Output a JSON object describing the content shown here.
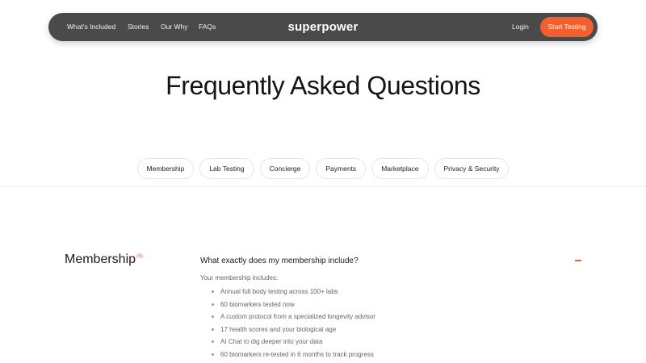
{
  "nav": {
    "links": [
      "What's Included",
      "Stories",
      "Our Why",
      "FAQs"
    ],
    "brand": "superpower",
    "login": "Login",
    "cta": "Start Testing"
  },
  "page_title": "Frequently Asked Questions",
  "categories": [
    "Membership",
    "Lab Testing",
    "Concierge",
    "Payments",
    "Marketplace",
    "Privacy & Security"
  ],
  "section": {
    "title": "Membership",
    "count": "(6)"
  },
  "faq": {
    "question": "What exactly does my membership include?",
    "answer_intro": "Your membership includes:",
    "answer_items": [
      "Annual full body testing across 100+ labs",
      "60 biomarkers tested now",
      "A custom protocol from a specialized longevity advisor",
      "17 health scores and your biological age",
      "AI Chat to dig deeper into your data",
      "60 biomarkers re-tested in 6 months to track progress"
    ]
  },
  "colors": {
    "accent": "#f3602d",
    "nav_bg": "#4a4a4a"
  }
}
